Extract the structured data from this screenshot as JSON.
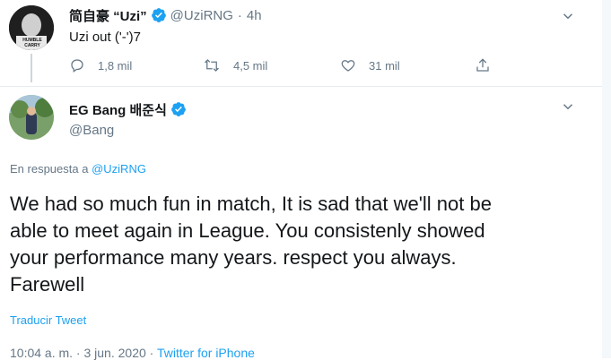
{
  "tweet1": {
    "display_name": "简自豪 “Uzi”",
    "handle": "@UziRNG",
    "sep": "·",
    "time_ago": "4h",
    "text": "Uzi out ('-')7",
    "avatar_text": "HUMBLE CARRY",
    "actions": {
      "reply_count": "1,8 mil",
      "retweet_count": "4,5 mil",
      "like_count": "31 mil"
    }
  },
  "tweet2": {
    "display_name": "EG Bang 배준식",
    "handle": "@Bang",
    "reply_prefix": "En respuesta a",
    "reply_to": "@UziRNG",
    "text_lines": [
      "We had so much fun in match, It is sad that we'll not be",
      "able to meet again in League. You consistenly showed",
      "your performance many years. respect you always.",
      "Farewell"
    ],
    "translate": "Traducir Tweet",
    "timestamp": "10:04 a. m. · 3 jun. 2020",
    "source_sep": "·",
    "source": "Twitter for iPhone"
  },
  "colors": {
    "accent": "#1da1f2",
    "muted": "#657786",
    "text": "#14171a"
  }
}
